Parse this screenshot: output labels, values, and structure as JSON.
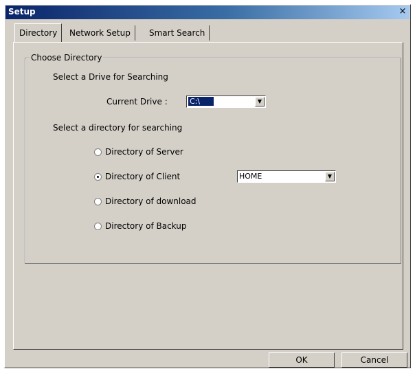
{
  "window": {
    "title": "Setup",
    "close_glyph": "×"
  },
  "tabs": [
    {
      "label": "Directory",
      "active": true
    },
    {
      "label": "Network Setup",
      "active": false
    },
    {
      "label": "Smart Search",
      "active": false
    }
  ],
  "group": {
    "legend": "Choose Directory",
    "drive_heading": "Select a Drive for Searching",
    "drive_label": "Current Drive :",
    "drive_value": "C:\\",
    "dir_heading": "Select a directory for searching",
    "options": [
      {
        "label": "Directory of Server",
        "checked": false
      },
      {
        "label": "Directory of Client",
        "checked": true
      },
      {
        "label": "Directory of download",
        "checked": false
      },
      {
        "label": "Directory of Backup",
        "checked": false
      }
    ],
    "client_dir_value": "HOME"
  },
  "buttons": {
    "ok": "OK",
    "cancel": "Cancel"
  },
  "icons": {
    "combo_arrow": "▼"
  },
  "colors": {
    "title_start": "#0a246a",
    "dialog_bg": "#d4d0c8",
    "selection": "#0a246a"
  }
}
